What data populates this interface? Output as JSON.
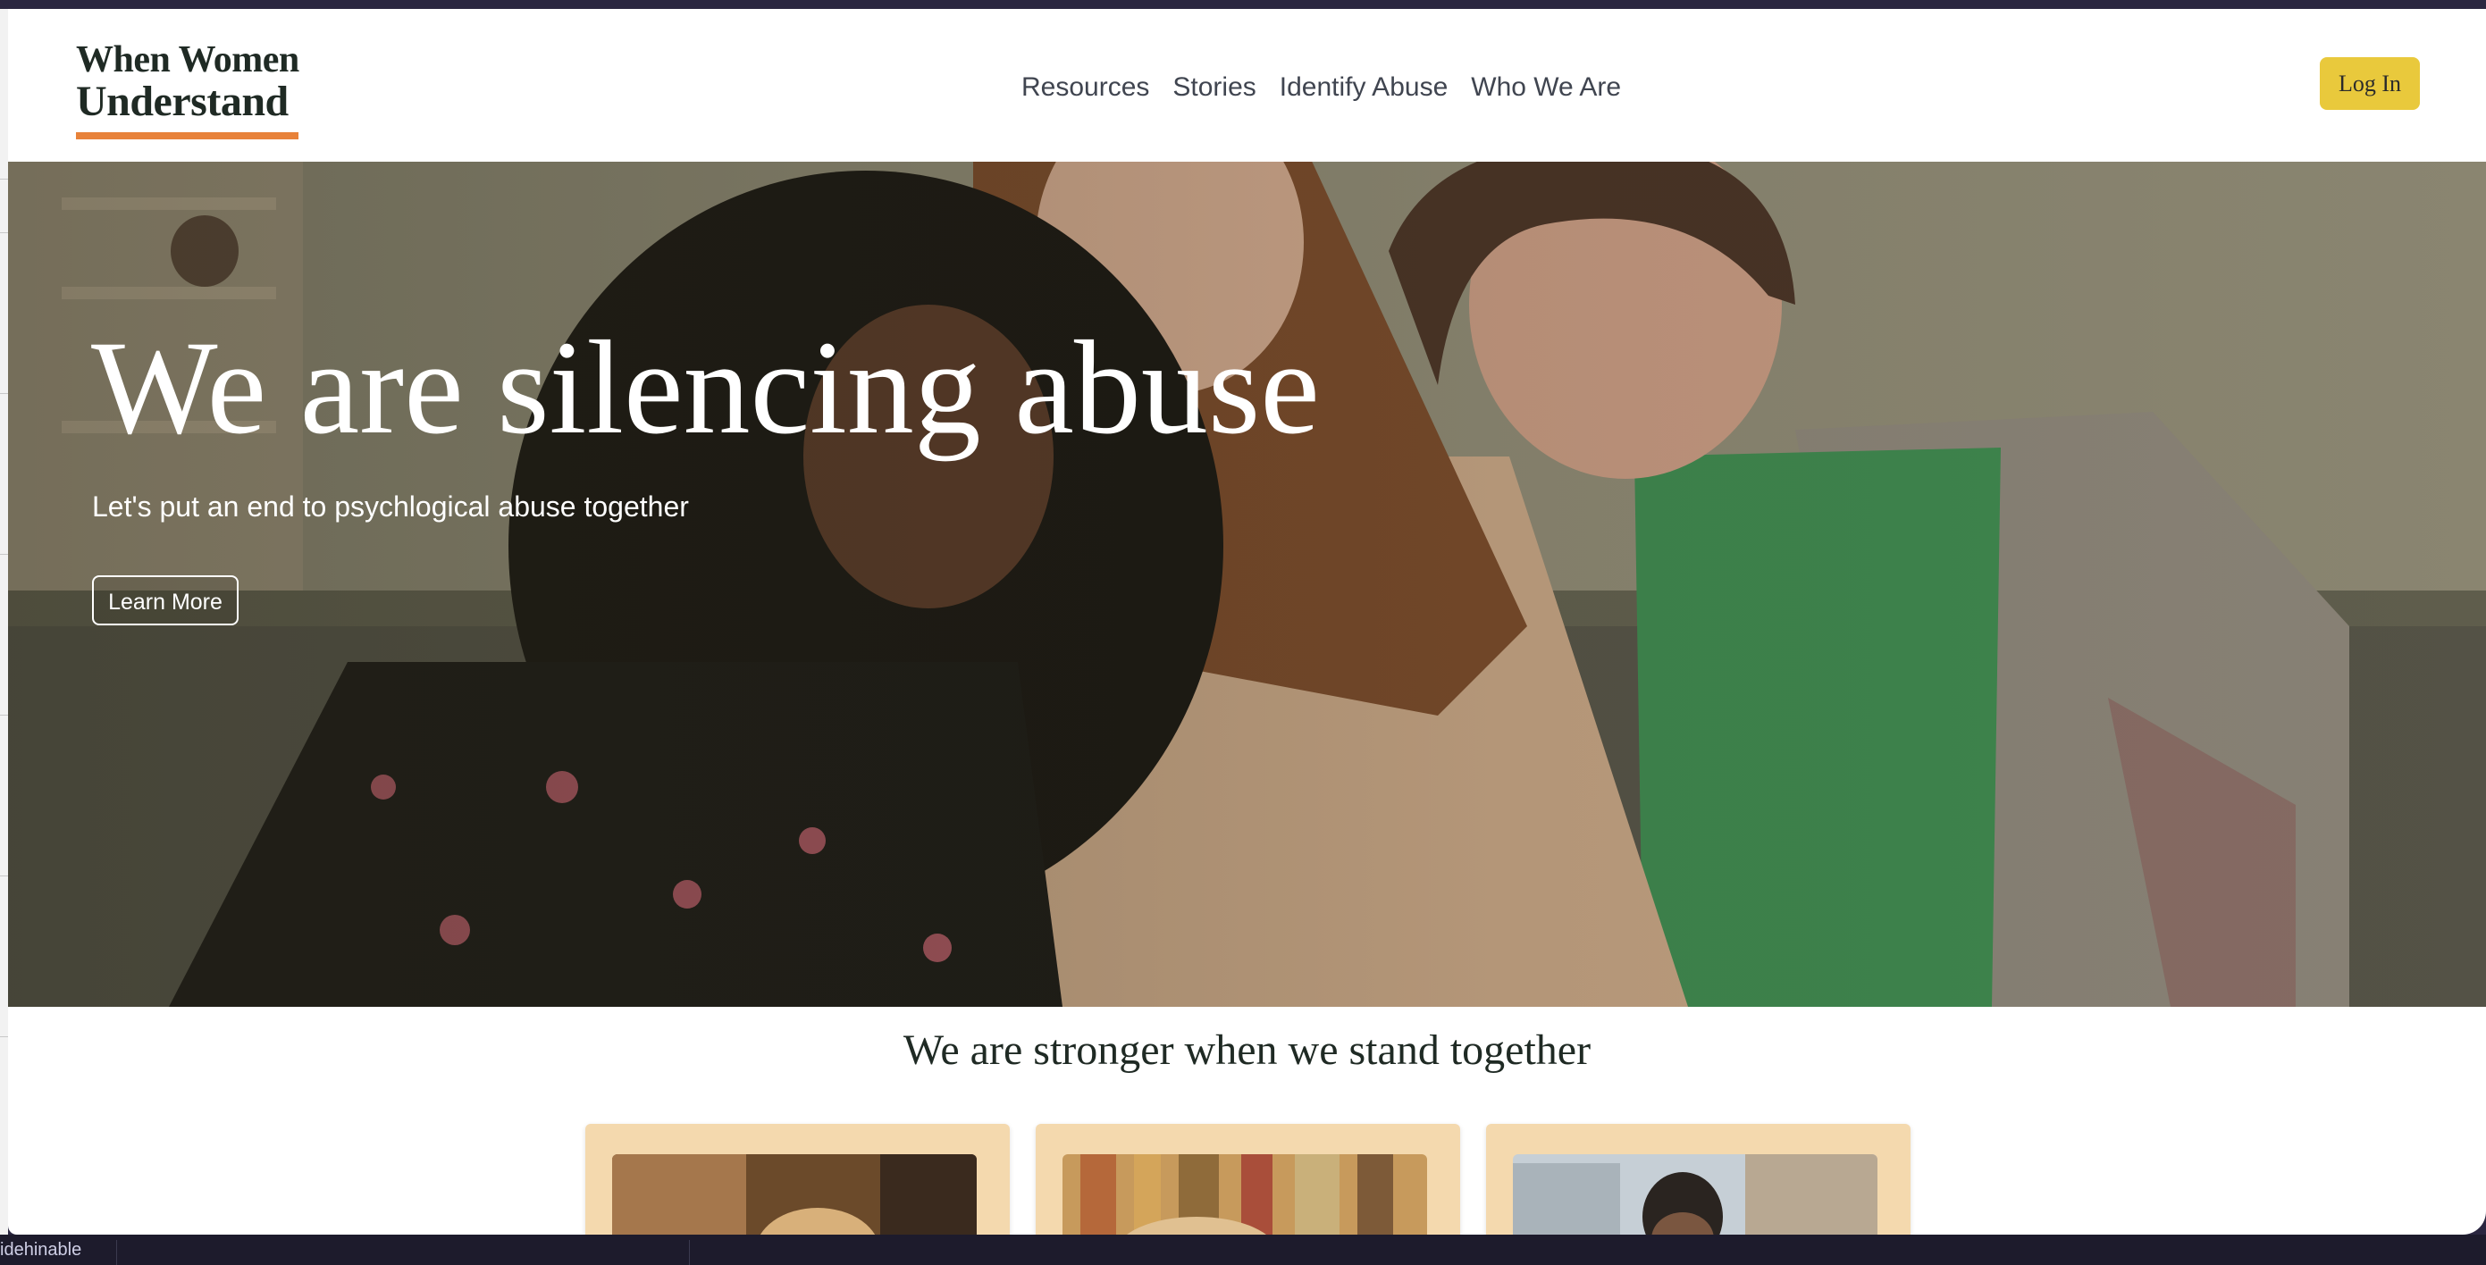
{
  "site": {
    "logo_line1": "When Women",
    "logo_line2": "Understand",
    "accent_color": "#e8823a"
  },
  "nav": {
    "items": [
      {
        "label": "Resources"
      },
      {
        "label": "Stories"
      },
      {
        "label": "Identify Abuse"
      },
      {
        "label": "Who We Are"
      }
    ],
    "login_label": "Log In",
    "login_color": "#e9c93c"
  },
  "hero": {
    "title": "We are silencing abuse",
    "subtitle": "Let's put an end to psychlogical abuse together",
    "cta_label": "Learn More",
    "image_icon": "hero-photo-three-women"
  },
  "section": {
    "title": "We are stronger when we stand together",
    "card_color": "#f4d9ae",
    "cards": [
      {
        "image_icon": "card-photo-woman-reading"
      },
      {
        "image_icon": "card-photo-bookshelf"
      },
      {
        "image_icon": "card-photo-man-outdoors"
      }
    ]
  },
  "desktop": {
    "bottom_label": "idehinable"
  }
}
